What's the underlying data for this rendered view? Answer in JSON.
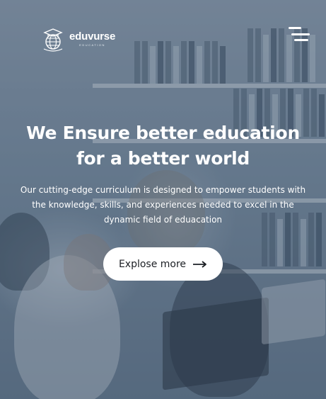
{
  "brand": {
    "name": "eduvurse",
    "tagline": "EDUCATION"
  },
  "nav": {
    "menu_icon": "hamburger-menu-icon"
  },
  "hero": {
    "headline_line1": "We Ensure better education",
    "headline_line2": "for a better world",
    "description_line1": "Our cutting-edge curriculum is designed to empower students with",
    "description_line2": "the knowledge, skills, and experiences needed to excel in the",
    "description_line3": "dynamic field of eduacation",
    "cta_label": "Explose more",
    "cta_icon": "arrow-right-icon"
  },
  "colors": {
    "overlay": "#6f8295",
    "text": "#ffffff",
    "button_bg": "#ffffff",
    "button_text": "#1c1f24"
  }
}
